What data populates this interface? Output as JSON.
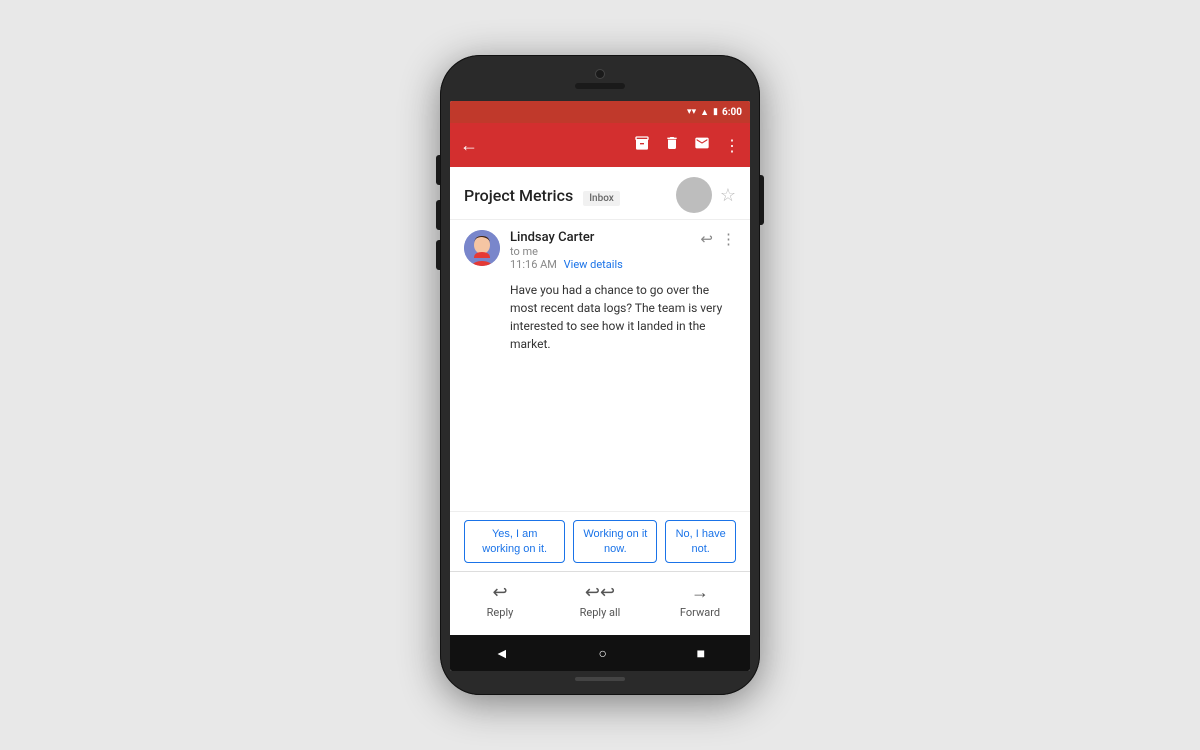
{
  "statusBar": {
    "time": "6:00",
    "icons": [
      "wifi",
      "signal",
      "battery"
    ]
  },
  "toolbar": {
    "backLabel": "←",
    "archiveLabel": "⬛",
    "deleteLabel": "🗑",
    "emailLabel": "✉",
    "moreLabel": "⋮"
  },
  "emailSubject": {
    "title": "Project Metrics",
    "badge": "Inbox"
  },
  "email": {
    "sender": "Lindsay Carter",
    "to": "to me",
    "time": "11:16 AM",
    "viewDetails": "View details",
    "body": "Have you had a chance to go over the most recent data logs? The team is very interested to see how it landed in the market."
  },
  "smartReplies": [
    "Yes, I am working on it.",
    "Working on it now.",
    "No, I have not."
  ],
  "bottomBar": {
    "reply": "Reply",
    "replyAll": "Reply all",
    "forward": "Forward"
  },
  "androidNav": {
    "back": "◄",
    "home": "○",
    "recent": "■"
  }
}
